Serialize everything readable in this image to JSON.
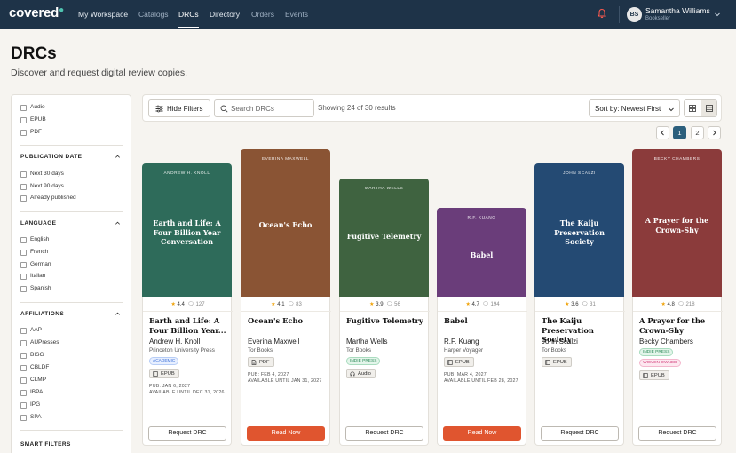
{
  "nav": {
    "logo": "covered",
    "items": [
      {
        "label": "My Workspace",
        "state": "dim-bright"
      },
      {
        "label": "Catalogs",
        "state": "dim"
      },
      {
        "label": "DRCs",
        "state": "active"
      },
      {
        "label": "Directory",
        "state": "dim-bright"
      },
      {
        "label": "Orders",
        "state": "dim"
      },
      {
        "label": "Events",
        "state": "dim"
      }
    ],
    "user": {
      "initials": "BS",
      "name": "Samantha Williams",
      "role": "Bookseller"
    }
  },
  "page": {
    "title": "DRCs",
    "subtitle": "Discover and request digital review copies."
  },
  "sidebar": {
    "formats": [
      "Audio",
      "EPUB",
      "PDF"
    ],
    "publication_date": {
      "heading": "PUBLICATION DATE",
      "options": [
        "Next 30 days",
        "Next 90 days",
        "Already published"
      ]
    },
    "language": {
      "heading": "LANGUAGE",
      "options": [
        "English",
        "French",
        "German",
        "Italian",
        "Spanish"
      ]
    },
    "affiliations": {
      "heading": "AFFILIATIONS",
      "options": [
        "AAP",
        "AUPresses",
        "BISG",
        "CBLDF",
        "CLMP",
        "IBPA",
        "IPG",
        "SPA"
      ]
    },
    "smart_filters": {
      "heading": "SMART FILTERS"
    }
  },
  "toolbar": {
    "hide_filters": "Hide Filters",
    "search_placeholder": "Search DRCs",
    "results": "Showing 24 of 30 results",
    "sort": "Sort by: Newest First"
  },
  "pagination": {
    "pages": [
      "1",
      "2"
    ],
    "current": "1"
  },
  "colors": {
    "nav_bg": "#1e3348",
    "accent": "#2c5f7c",
    "read_now": "#e0552f",
    "star": "#f0a30a"
  },
  "cards": [
    {
      "cover_author": "ANDREW H. KNOLL",
      "cover_title": "Earth and Life: A Four Billion Year Conversation",
      "cover_color": "#2e6b5a",
      "rating": "4.4",
      "comments": "127",
      "title": "Earth and Life: A Four Billion Year...",
      "author": "Andrew H. Knoll",
      "publisher": "Princeton University Press",
      "tags": [
        {
          "label": "ACADEMIC",
          "kind": "academic"
        }
      ],
      "formats": [
        {
          "label": "EPUB",
          "icon": "book-icon"
        }
      ],
      "pub_date": "PUB: JAN 6, 2027",
      "available": "AVAILABLE UNTIL DEC 31, 2026",
      "action": "Request DRC",
      "action_kind": "request"
    },
    {
      "cover_author": "EVERINA MAXWELL",
      "cover_title": "Ocean's Echo",
      "cover_color": "#8a5434",
      "rating": "4.1",
      "comments": "83",
      "title": "Ocean's Echo",
      "author": "Everina Maxwell",
      "publisher": "Tor Books",
      "tags": [],
      "formats": [
        {
          "label": "PDF",
          "icon": "document-icon"
        }
      ],
      "pub_date": "PUB: FEB 4, 2027",
      "available": "AVAILABLE UNTIL JAN 31, 2027",
      "action": "Read Now",
      "action_kind": "read"
    },
    {
      "cover_author": "MARTHA WELLS",
      "cover_title": "Fugitive Telemetry",
      "cover_color": "#3f6340",
      "rating": "3.9",
      "comments": "56",
      "title": "Fugitive Telemetry",
      "author": "Martha Wells",
      "publisher": "Tor Books",
      "tags": [
        {
          "label": "INDIE PRESS",
          "kind": "indie"
        }
      ],
      "formats": [
        {
          "label": "Audio",
          "icon": "headphones-icon"
        }
      ],
      "pub_date": "",
      "available": "",
      "action": "Request DRC",
      "action_kind": "request"
    },
    {
      "cover_author": "R.F. KUANG",
      "cover_title": "Babel",
      "cover_color": "#6a3d7a",
      "rating": "4.7",
      "comments": "194",
      "title": "Babel",
      "author": "R.F. Kuang",
      "publisher": "Harper Voyager",
      "tags": [],
      "formats": [
        {
          "label": "EPUB",
          "icon": "book-icon"
        }
      ],
      "pub_date": "PUB: MAR 4, 2027",
      "available": "AVAILABLE UNTIL FEB 28, 2027",
      "action": "Read Now",
      "action_kind": "read"
    },
    {
      "cover_author": "JOHN SCALZI",
      "cover_title": "The Kaiju Preservation Society",
      "cover_color": "#244a73",
      "rating": "3.6",
      "comments": "31",
      "title": "The Kaiju Preservation Society",
      "author": "John Scalzi",
      "publisher": "Tor Books",
      "tags": [],
      "formats": [
        {
          "label": "EPUB",
          "icon": "book-icon"
        }
      ],
      "pub_date": "",
      "available": "",
      "action": "Request DRC",
      "action_kind": "request"
    },
    {
      "cover_author": "BECKY CHAMBERS",
      "cover_title": "A Prayer for the Crown-Shy",
      "cover_color": "#8b3b3b",
      "rating": "4.8",
      "comments": "218",
      "title": "A Prayer for the Crown-Shy",
      "author": "Becky Chambers",
      "publisher": "",
      "tags": [
        {
          "label": "INDIE PRESS",
          "kind": "indie"
        },
        {
          "label": "WOMEN OWNED",
          "kind": "women"
        }
      ],
      "formats": [
        {
          "label": "EPUB",
          "icon": "book-icon"
        }
      ],
      "pub_date": "",
      "available": "",
      "action": "Request DRC",
      "action_kind": "request"
    }
  ]
}
